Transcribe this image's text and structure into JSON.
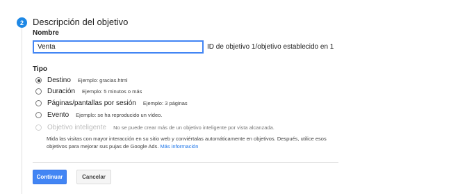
{
  "step": {
    "number": "2",
    "title": "Descripción del objetivo"
  },
  "name": {
    "label": "Nombre",
    "value": "Venta",
    "id_text": "ID de objetivo 1/objetivo establecido en 1"
  },
  "type": {
    "label": "Tipo",
    "options": [
      {
        "label": "Destino",
        "example": "Ejemplo: gracias.html",
        "selected": true
      },
      {
        "label": "Duración",
        "example": "Ejemplo: 5 minutos o más",
        "selected": false
      },
      {
        "label": "Páginas/pantallas por sesión",
        "example": "Ejemplo: 3 páginas",
        "selected": false
      },
      {
        "label": "Evento",
        "example": "Ejemplo: se ha reproducido un vídeo.",
        "selected": false
      },
      {
        "label": "Objetivo inteligente",
        "example": "No se puede crear más de un objetivo inteligente por vista alcanzada.",
        "selected": false,
        "disabled": true
      }
    ],
    "smart_description": "Mida las visitas con mayor interacción en su sitio web y conviértalas automáticamente en objetivos. Después, utilice esos objetivos para mejorar sus pujas de Google Ads.",
    "smart_link": "Más información"
  },
  "buttons": {
    "continue": "Continuar",
    "cancel": "Cancelar"
  },
  "colors": {
    "accent": "#4285f4",
    "badge": "#1e88e5",
    "link": "#1a73e8"
  }
}
